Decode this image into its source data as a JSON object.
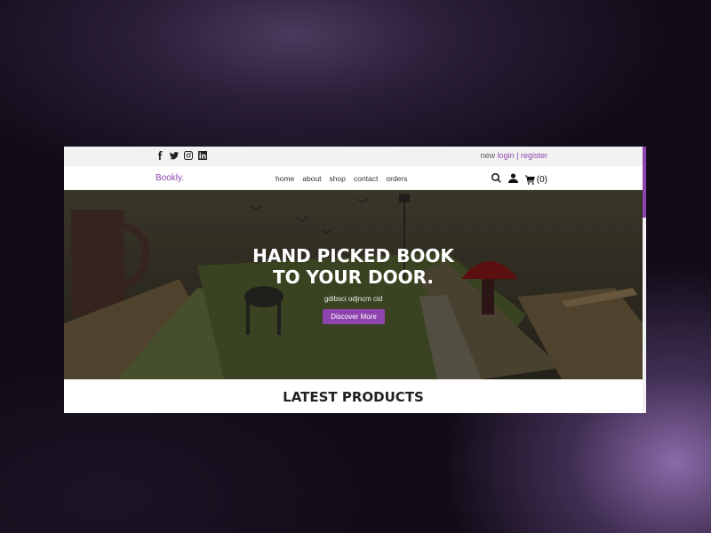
{
  "topbar": {
    "social_icons": [
      "facebook-icon",
      "twitter-icon",
      "instagram-icon",
      "linkedin-icon"
    ],
    "auth_prefix": "new",
    "login_label": "login",
    "separator": "|",
    "register_label": "register"
  },
  "navbar": {
    "logo": "Bookly.",
    "menu": [
      "home",
      "about",
      "shop",
      "contact",
      "orders"
    ],
    "icons": [
      "search-icon",
      "user-icon",
      "cart-icon"
    ],
    "cart_count": "(0)"
  },
  "hero": {
    "title_line1": "HAND PICKED BOOK",
    "title_line2": "TO YOUR DOOR.",
    "subtitle": "gdibsci odjncm cid",
    "button_label": "Discover More"
  },
  "latest": {
    "title": "LATEST PRODUCTS"
  },
  "colors": {
    "accent": "#8e44ad",
    "topbar_bg": "#f2f2f2",
    "backdrop": "#120c18"
  }
}
